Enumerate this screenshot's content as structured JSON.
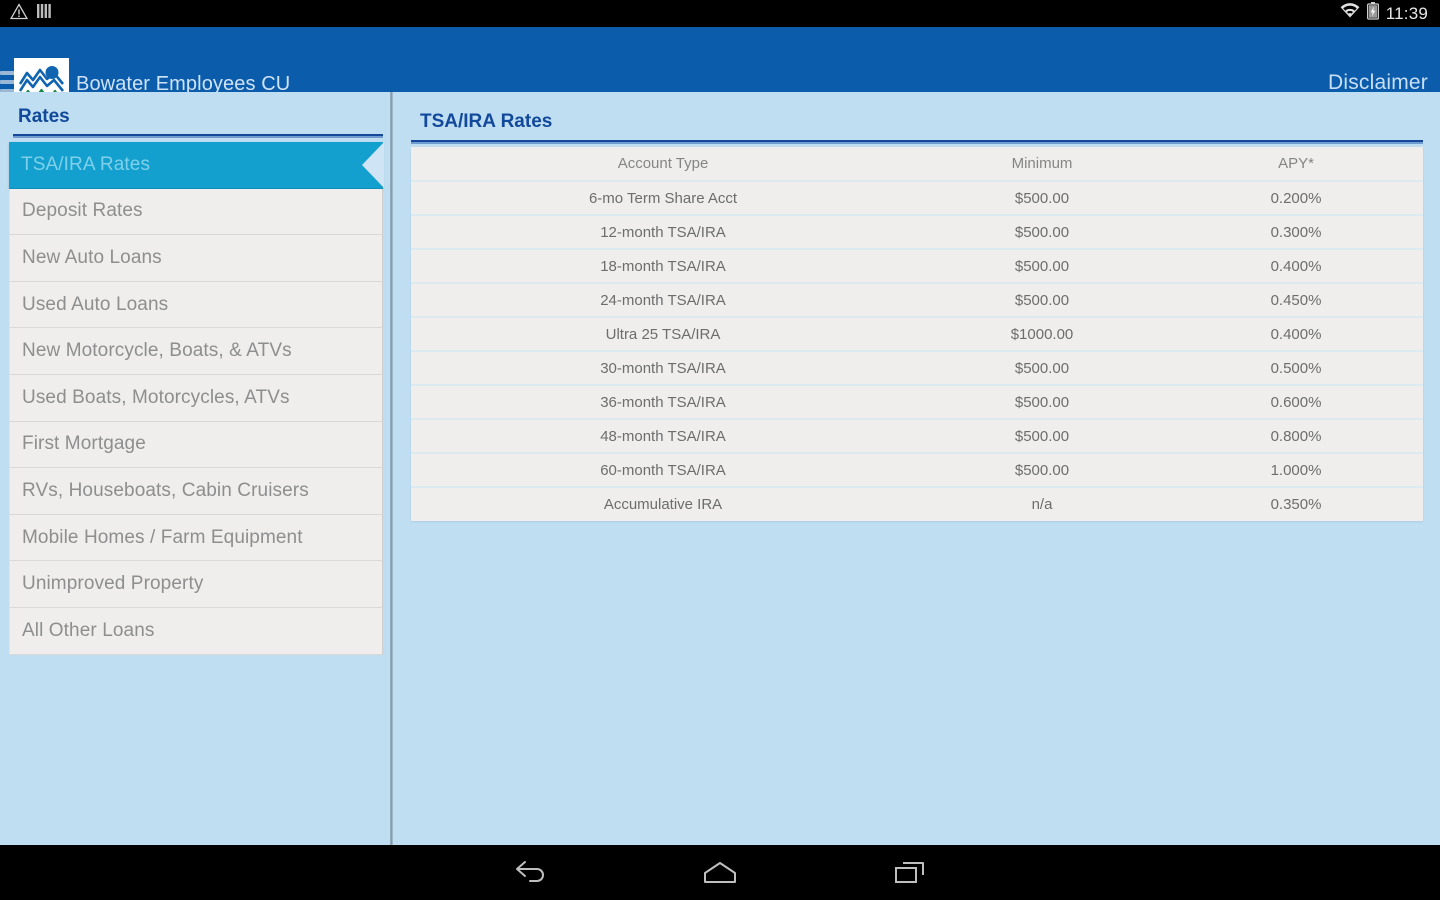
{
  "statusbar": {
    "time": "11:39",
    "icons": [
      "warning-triangle-icon",
      "sim-signal-icon",
      "wifi-icon",
      "battery-charging-icon"
    ]
  },
  "actionbar": {
    "title": "Bowater Employees CU",
    "action_label": "Disclaimer",
    "menu_icon": "hamburger-menu-icon",
    "logo_icon": "credit-union-logo",
    "background": "#0b5cab"
  },
  "sidebar": {
    "title": "Rates",
    "selected_index": 0,
    "items": [
      {
        "label": "TSA/IRA Rates"
      },
      {
        "label": "Deposit Rates"
      },
      {
        "label": "New Auto Loans"
      },
      {
        "label": "Used Auto Loans"
      },
      {
        "label": "New Motorcycle, Boats, & ATVs"
      },
      {
        "label": "Used Boats, Motorcycles, ATVs"
      },
      {
        "label": "First Mortgage"
      },
      {
        "label": "RVs, Houseboats, Cabin Cruisers"
      },
      {
        "label": "Mobile Homes / Farm Equipment"
      },
      {
        "label": "Unimproved Property"
      },
      {
        "label": "All Other Loans"
      }
    ]
  },
  "main": {
    "title": "TSA/IRA Rates",
    "table": {
      "columns": [
        "Account Type",
        "Minimum",
        "APY*"
      ],
      "rows": [
        [
          "6-mo Term Share Acct",
          "$500.00",
          "0.200%"
        ],
        [
          "12-month TSA/IRA",
          "$500.00",
          "0.300%"
        ],
        [
          "18-month TSA/IRA",
          "$500.00",
          "0.400%"
        ],
        [
          "24-month TSA/IRA",
          "$500.00",
          "0.450%"
        ],
        [
          "Ultra 25 TSA/IRA",
          "$1000.00",
          "0.400%"
        ],
        [
          "30-month TSA/IRA",
          "$500.00",
          "0.500%"
        ],
        [
          "36-month TSA/IRA",
          "$500.00",
          "0.600%"
        ],
        [
          "48-month TSA/IRA",
          "$500.00",
          "0.800%"
        ],
        [
          "60-month TSA/IRA",
          "$500.00",
          "1.000%"
        ],
        [
          "Accumulative IRA",
          "n/a",
          "0.350%"
        ]
      ]
    }
  },
  "navbar": {
    "buttons": [
      {
        "name": "back-icon"
      },
      {
        "name": "home-icon"
      },
      {
        "name": "recent-apps-icon"
      }
    ]
  },
  "colors": {
    "brand_blue": "#0b5cab",
    "accent_cyan": "#14a0ce",
    "page_background": "#bfdef2",
    "row_background": "#efeeec",
    "heading_blue": "#12499a"
  }
}
